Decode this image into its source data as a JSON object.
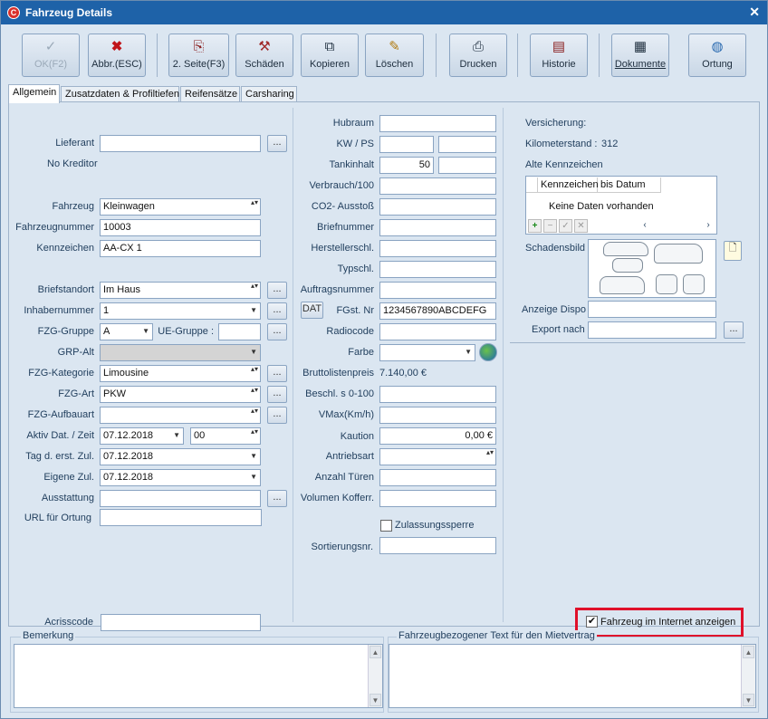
{
  "window": {
    "title": "Fahrzeug Details"
  },
  "toolbar": {
    "ok": "OK(F2)",
    "abbr": "Abbr.(ESC)",
    "seite2": "2. Seite(F3)",
    "schaeden": "Schäden",
    "kopieren": "Kopieren",
    "loeschen": "Löschen",
    "drucken": "Drucken",
    "historie": "Historie",
    "dokumente": "Dokumente",
    "ortung": "Ortung"
  },
  "tabs": [
    "Allgemein",
    "Zusatzdaten & Profiltiefen",
    "Reifensätze",
    "Carsharing"
  ],
  "left": {
    "lieferant_label": "Lieferant",
    "lieferant_value": "",
    "no_kreditor": "No Kreditor",
    "fahrzeug_label": "Fahrzeug",
    "fahrzeug_value": "Kleinwagen",
    "fahrzeugnummer_label": "Fahrzeugnummer",
    "fahrzeugnummer_value": "10003",
    "kennzeichen_label": "Kennzeichen",
    "kennzeichen_value": "AA-CX 1",
    "briefstandort_label": "Briefstandort",
    "briefstandort_value": "Im Haus",
    "inhabernummer_label": "Inhabernummer",
    "inhabernummer_value": "1",
    "fzg_gruppe_label": "FZG-Gruppe",
    "fzg_gruppe_value": "A",
    "ue_gruppe_label": "UE-Gruppe :",
    "ue_gruppe_value": "",
    "grp_alt_label": "GRP-Alt",
    "grp_alt_value": "",
    "fzg_kategorie_label": "FZG-Kategorie",
    "fzg_kategorie_value": "Limousine",
    "fzg_art_label": "FZG-Art",
    "fzg_art_value": "PKW",
    "fzg_aufbauart_label": "FZG-Aufbauart",
    "fzg_aufbauart_value": "",
    "aktiv_label": "Aktiv Dat. / Zeit",
    "aktiv_date": "07.12.2018",
    "aktiv_time": "00",
    "tag_label": "Tag d. erst. Zul.",
    "tag_value": "07.12.2018",
    "eigene_label": "Eigene Zul.",
    "eigene_value": "07.12.2018",
    "ausstattung_label": "Ausstattung",
    "ausstattung_value": "",
    "url_label": "URL für Ortung",
    "url_value": "",
    "acriss_label": "Acrisscode",
    "acriss_value": ""
  },
  "mid": {
    "hubraum": "Hubraum",
    "kw_ps": "KW / PS",
    "tankinhalt": "Tankinhalt",
    "tankinhalt_value": "50",
    "verbrauch": "Verbrauch/100",
    "co2": "CO2- Ausstoß",
    "briefnummer": "Briefnummer",
    "herstellerschl": "Herstellerschl.",
    "typschl": "Typschl.",
    "auftragsnummer": "Auftragsnummer",
    "dat": "DAT",
    "fgst": "FGst. Nr",
    "fgst_value": "1234567890ABCDEFG",
    "radiocode": "Radiocode",
    "farbe": "Farbe",
    "bruttolistenpreis": "Bruttolistenpreis",
    "bruttolistenpreis_value": "7.140,00 €",
    "beschl": "Beschl. s 0-100",
    "vmax": "VMax(Km/h)",
    "kaution": "Kaution",
    "kaution_value": "0,00 €",
    "antriebsart": "Antriebsart",
    "anzahl_tueren": "Anzahl Türen",
    "volumen": "Volumen Kofferr.",
    "zulassungssperre": "Zulassungssperre",
    "sortierungsnr": "Sortierungsnr."
  },
  "right": {
    "versicherung": "Versicherung:",
    "km_label": "Kilometerstand :",
    "km_value": "312",
    "alte_kennzeichen": "Alte Kennzeichen",
    "col_kennzeichen": "Kennzeichen",
    "col_bis_datum": "bis Datum",
    "keine_daten": "Keine Daten vorhanden",
    "schadensbild": "Schadensbild",
    "anzeige_dispo": "Anzeige Dispo",
    "export_nach": "Export nach",
    "internet_label": "Fahrzeug im Internet anzeigen"
  },
  "bottom": {
    "bemerkung": "Bemerkung",
    "fahrzeugtext": "Fahrzeugbezogener Text für den Mietvertrag"
  },
  "colors": {
    "titlebar": "#1e62a8",
    "highlight": "#e0102a",
    "panel": "#dbe6f1"
  }
}
